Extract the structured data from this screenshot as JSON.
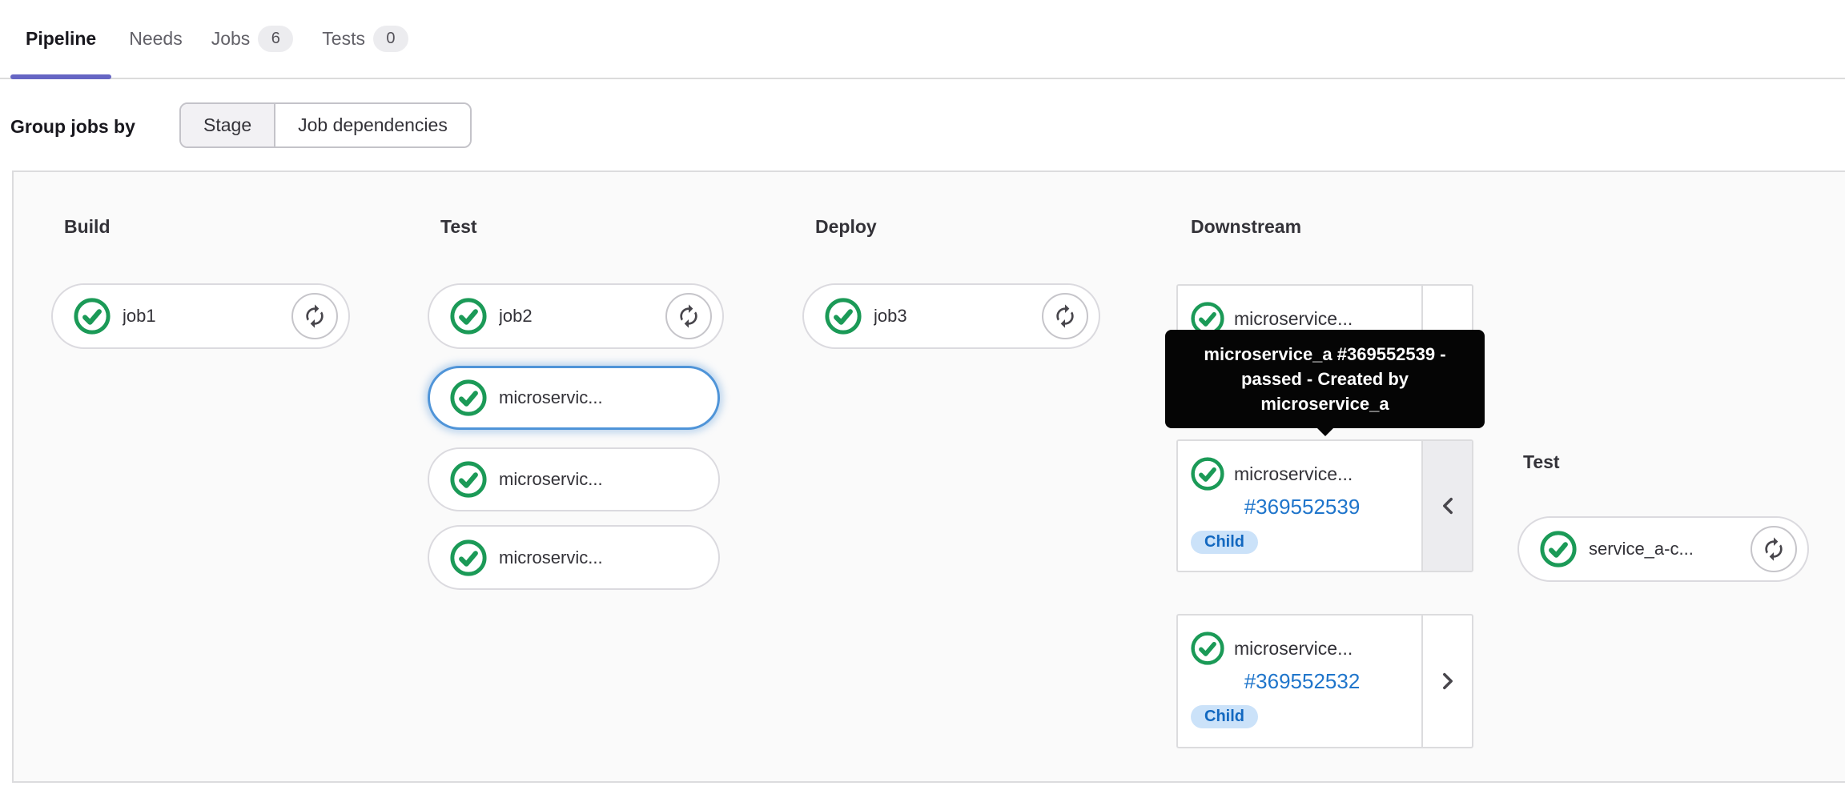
{
  "header": {
    "tabs": [
      {
        "label": "Pipeline",
        "active": true
      },
      {
        "label": "Needs",
        "active": false
      },
      {
        "label": "Jobs",
        "badge": "6",
        "active": false
      },
      {
        "label": "Tests",
        "badge": "0",
        "active": false
      }
    ]
  },
  "controls": {
    "group_jobs_by_label": "Group jobs by",
    "group_options": [
      {
        "label": "Stage",
        "selected": true
      },
      {
        "label": "Job dependencies",
        "selected": false
      }
    ]
  },
  "pipeline": {
    "stages": [
      {
        "name": "Build",
        "jobs": [
          {
            "name": "job1",
            "status": "passed",
            "has_retry": true
          }
        ]
      },
      {
        "name": "Test",
        "jobs": [
          {
            "name": "job2",
            "status": "passed",
            "has_retry": true
          },
          {
            "name": "microservic...",
            "status": "passed",
            "highlighted": true
          },
          {
            "name": "microservic...",
            "status": "passed"
          },
          {
            "name": "microservic...",
            "status": "passed"
          }
        ]
      },
      {
        "name": "Deploy",
        "jobs": [
          {
            "name": "job3",
            "status": "passed",
            "has_retry": true
          }
        ]
      }
    ],
    "downstream": {
      "title": "Downstream",
      "cards": [
        {
          "name": "microservice...",
          "status": "passed"
        },
        {
          "name": "microservice...",
          "status": "passed",
          "pipeline_id": "#369552539",
          "badge": "Child",
          "chevron": "left",
          "expanded": true
        },
        {
          "name": "microservice...",
          "status": "passed",
          "pipeline_id": "#369552532",
          "badge": "Child",
          "chevron": "right",
          "expanded": false
        }
      ]
    },
    "child_pipeline": {
      "stage_name": "Test",
      "jobs": [
        {
          "name": "service_a-c...",
          "status": "passed",
          "has_retry": true
        }
      ]
    },
    "tooltip": {
      "text": "microservice_a #369552539 - passed - Created by microservice_a"
    }
  },
  "colors": {
    "accent_purple": "#6666c4",
    "success_green": "#1b9a57",
    "link_blue": "#1f75cb",
    "badge_info_bg": "#cbe2f9",
    "badge_info_text": "#1268c0",
    "focus_ring_blue": "#4f94d8",
    "tooltip_bg": "#050505",
    "graph_bg": "#fafafa",
    "border_gray": "#dcdcde"
  },
  "icons": {
    "status_success": "status-success-icon",
    "retry": "retry-icon",
    "chevron_left": "chevron-left-icon",
    "chevron_right": "chevron-right-icon"
  }
}
